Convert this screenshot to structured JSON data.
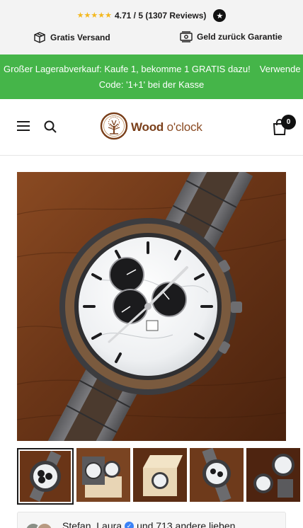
{
  "topbar": {
    "rating_text": "4.71 / 5 (1307 Reviews)",
    "star_count": 5,
    "badge_icon": "star-seal-icon",
    "usps": [
      {
        "label": "Gratis Versand",
        "icon": "package-icon"
      },
      {
        "label": "Geld zurück Garantie",
        "icon": "money-icon"
      }
    ]
  },
  "promo": {
    "line1": "Großer Lagerabverkauf: Kaufe 1, bekomme 1 GRATIS dazu!",
    "line1_tail": "Verwende",
    "line2": "Code: '1+1' bei der Kasse",
    "background_color": "#45b549"
  },
  "header": {
    "menu_icon": "hamburger-menu-icon",
    "search_icon": "search-icon",
    "logo_text_bold": "Wood",
    "logo_text_light": "o'clock",
    "cart_icon": "shopping-bag-icon",
    "cart_count": "0"
  },
  "gallery": {
    "main_image_alt": "wooden-chronograph-watch-white-marble-dial",
    "thumbnail_count": 5,
    "active_thumbnail": 1
  },
  "social_proof": {
    "names": "Stefan, Laura",
    "suffix": "und 713 andere lieben"
  },
  "colors": {
    "promo_green": "#45b549",
    "topbar_bg": "#f3f3f3",
    "star_gold": "#f3b81f",
    "logo_brown": "#7a3f1a"
  }
}
